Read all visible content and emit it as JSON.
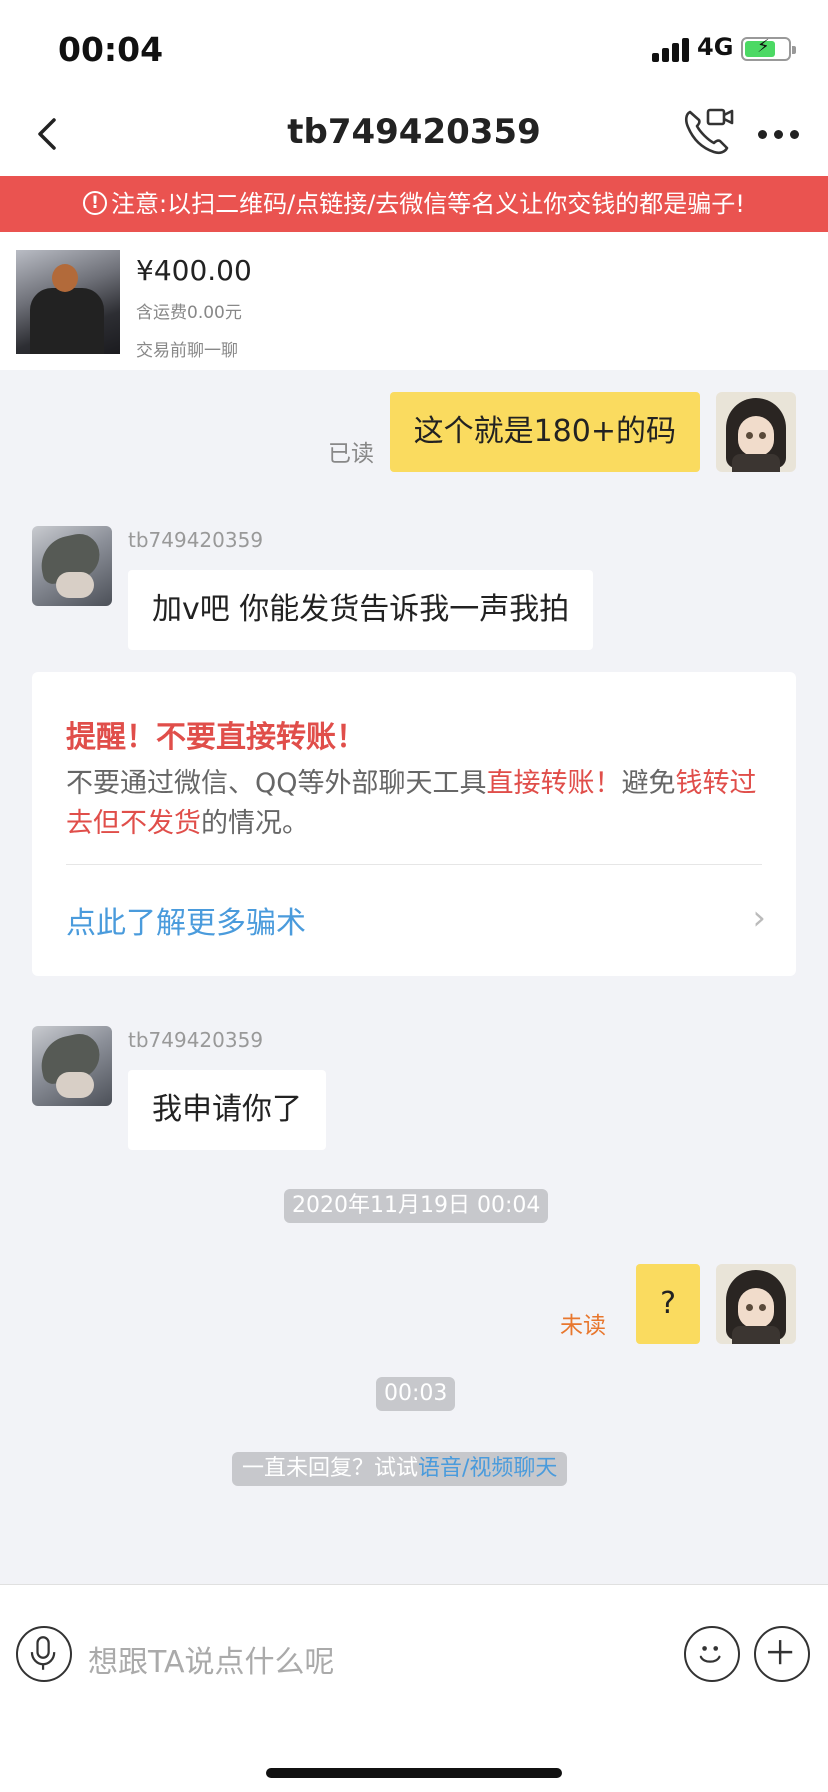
{
  "status_bar": {
    "time": "00:04",
    "network": "4G"
  },
  "header": {
    "title": "tb749420359"
  },
  "warning": {
    "text": "注意:以扫二维码/点链接/去微信等名义让你交钱的都是骗子!"
  },
  "product": {
    "price": "¥400.00",
    "shipping": "含运费0.00元",
    "note": "交易前聊一聊"
  },
  "messages": [
    {
      "from": "me",
      "text": "这个就是180+的码",
      "status": "已读"
    },
    {
      "from": "other",
      "sender": "tb749420359",
      "text": "加v吧 你能发货告诉我一声我拍"
    },
    {
      "from": "other",
      "sender": "tb749420359",
      "text": "我申请你了"
    },
    {
      "from": "me",
      "text": "?",
      "status": "未读"
    }
  ],
  "reminder": {
    "title": "提醒！不要直接转账！",
    "text_1": "不要通过微信、QQ等外部聊天工具",
    "text_2": "直接转账！",
    "text_3": "避免",
    "text_4": "钱转过去但不发货",
    "text_5": "的情况。",
    "link": "点此了解更多骗术"
  },
  "timestamps": {
    "first": "2020年11月19日 00:04",
    "second": "00:03"
  },
  "hint": {
    "text": "一直未回复？试试",
    "link": "语音/视频聊天"
  },
  "input": {
    "placeholder": "想跟TA说点什么呢"
  },
  "colors": {
    "warning_bg": "#ea5350",
    "bubble_me": "#fadb5f",
    "link": "#4a9bdc",
    "alert_red": "#e04e4a"
  }
}
